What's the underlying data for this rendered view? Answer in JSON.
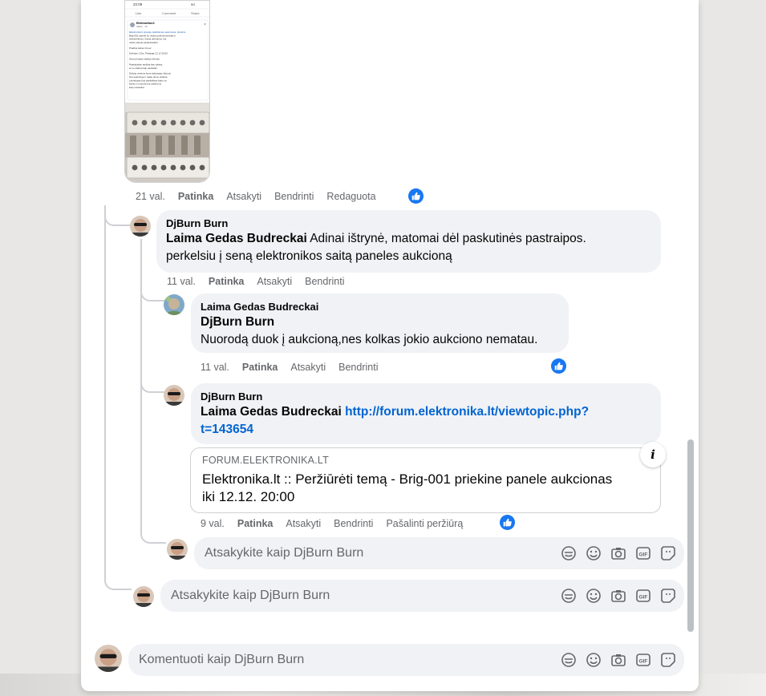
{
  "screenshot": {
    "status_time": "22:09",
    "status_net": "5G",
    "actions": [
      "Like",
      "Comment",
      "Share"
    ],
    "post_author": "Elektronika.lt",
    "post_meta": "Vakar · 12",
    "post_lines": [
      "Elektronika.lt grupėje skelbiamas aukcionas: priekinė",
      "Brig-001 panelė su visais potenciometrais ir",
      "rankenėlėmis. Kaina derinama, kur",
      "rasite panelę pasiteiraukite.",
      "",
      "Pradinė kaina 10 eur",
      "",
      "Kelintas 1 Eur. Pabaiga 12.12 20:00",
      "",
      "Siuntų būdas skaityti žemiau.",
      "",
      "Paskaitykite atidžiai kas vyksta,",
      "ar ne dažnai taip pasitaiko.",
      "",
      "Dėkoju visiems kurie dalyvauja, tikiuosi",
      "bus sėkminga ir rasite tai ko ieškote.",
      "Laimėtojas bus paskelbtas kartu su",
      "kaina ir nuoroda kur atsiimti ar",
      "kaip susisiekti."
    ]
  },
  "comment0_actions": {
    "time": "21 val.",
    "like": "Patinka",
    "reply": "Atsakyti",
    "share": "Bendrinti",
    "edited": "Redaguota"
  },
  "comment1": {
    "author": "DjBurn Burn",
    "mention": "Laima Gedas Budreckai",
    "text_a": " Adinai ištrynė, matomai dėl paskutinės pastraipos.",
    "text_b": "perkelsiu į seną elektronikos saitą paneles aukcioną",
    "time": "11 val.",
    "like": "Patinka",
    "reply": "Atsakyti",
    "share": "Bendrinti"
  },
  "comment2": {
    "author": "Laima Gedas Budreckai",
    "mention": "DjBurn Burn",
    "text": "Nuorodą duok į aukcioną,nes kolkas jokio aukciono nematau.",
    "time": "11 val.",
    "like": "Patinka",
    "reply": "Atsakyti",
    "share": "Bendrinti"
  },
  "comment3": {
    "author": "DjBurn Burn",
    "mention": "Laima Gedas Budreckai",
    "link_a": "http://forum.elektronika.lt/viewtopic.php?",
    "link_b": "t=143654",
    "preview_domain": "FORUM.ELEKTRONIKA.LT",
    "preview_title_a": "Elektronika.lt :: Peržiūrėti temą - Brig-001 priekine panele aukcionas",
    "preview_title_b": "iki 12.12. 20:00",
    "info_glyph": "i",
    "time": "9 val.",
    "like": "Patinka",
    "reply": "Atsakyti",
    "share": "Bendrinti",
    "remove_preview": "Pašalinti peržiūrą"
  },
  "composers": {
    "reply_nested": "Atsakykite kaip DjBurn Burn",
    "reply_thread": "Atsakykite kaip DjBurn Burn",
    "main_comment": "Komentuoti kaip DjBurn Burn"
  },
  "colors": {
    "accent": "#1877f2",
    "link": "#0064d1",
    "bubble": "#f0f2f5",
    "muted": "#65676b"
  },
  "icons": [
    "avatar-icon",
    "like-icon",
    "sticker-icon",
    "emoji-icon",
    "camera-icon",
    "gif-icon",
    "avatar-sticker-icon",
    "info-icon"
  ]
}
